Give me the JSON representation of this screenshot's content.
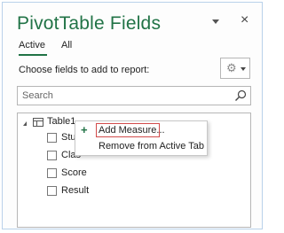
{
  "pane": {
    "title": "PivotTable Fields",
    "close_symbol": "×",
    "tabs": [
      {
        "label": "Active",
        "active": true
      },
      {
        "label": "All",
        "active": false
      }
    ],
    "choose_label": "Choose fields to add to report:",
    "search": {
      "placeholder": "Search",
      "value": ""
    },
    "accent_color": "#217346"
  },
  "field_list": {
    "table_name": "Table1",
    "fields": [
      {
        "label": "Stud",
        "checked": false
      },
      {
        "label": "Clas",
        "checked": false
      },
      {
        "label": "Score",
        "checked": false
      },
      {
        "label": "Result",
        "checked": false
      }
    ]
  },
  "context_menu": {
    "items": [
      {
        "label": "Add Measure...",
        "icon": "plus-icon",
        "highlighted": true
      },
      {
        "label": "Remove from Active Tab",
        "icon": "",
        "highlighted": false
      }
    ],
    "highlight_color": "#d24b4b"
  },
  "icons": {
    "gear": "gear-icon",
    "search": "search-icon",
    "table": "table-icon"
  }
}
